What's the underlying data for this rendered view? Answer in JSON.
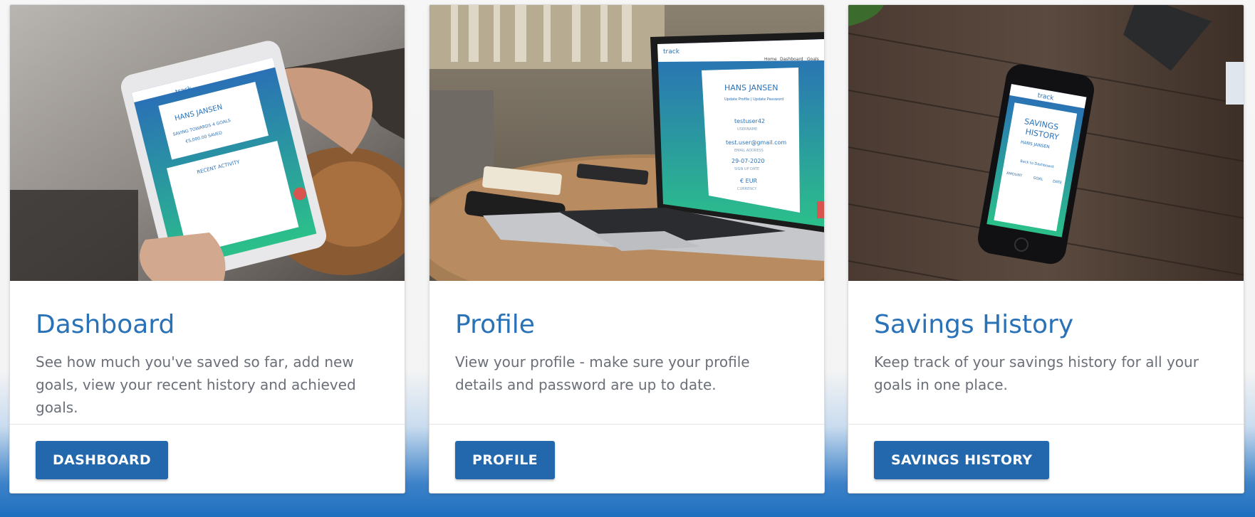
{
  "cards": [
    {
      "title": "Dashboard",
      "text": "See how much you've saved so far, add new goals, view your recent history and achieved goals.",
      "button": "DASHBOARD",
      "screen": {
        "logo": "track",
        "name": "HANS JANSEN",
        "line1": "SAVING TOWARDS 4 GOALS",
        "line2": "€5,000.00 SAVED",
        "section": "RECENT ACTIVITY"
      }
    },
    {
      "title": "Profile",
      "text": "View your profile - make sure your profile details and password are up to date.",
      "button": "PROFILE",
      "screen": {
        "logo": "track",
        "nav": [
          "Home",
          "Dashboard",
          "Goals"
        ],
        "name": "HANS JANSEN",
        "sub": "Update Profile | Update Password",
        "username": "testuser42",
        "username_label": "USERNAME",
        "email": "test.user@gmail.com",
        "email_label": "EMAIL ADDRESS",
        "date": "29-07-2020",
        "date_label": "SIGN UP DATE",
        "currency": "€ EUR",
        "currency_label": "CURRENCY"
      }
    },
    {
      "title": "Savings History",
      "text": "Keep track of your savings history for all your goals in one place.",
      "button": "SAVINGS HISTORY",
      "screen": {
        "logo": "track",
        "heading1": "SAVINGS",
        "heading2": "HISTORY",
        "name": "HANS JANSEN",
        "link": "Back to Dashboard",
        "cols": [
          "AMOUNT",
          "GOAL",
          "DATE"
        ]
      }
    }
  ],
  "colors": {
    "title": "#2a72b8",
    "button": "#2367ad",
    "text": "#6a6f78",
    "screen_top": "#2a6cb8",
    "screen_bottom": "#2bc08a"
  }
}
